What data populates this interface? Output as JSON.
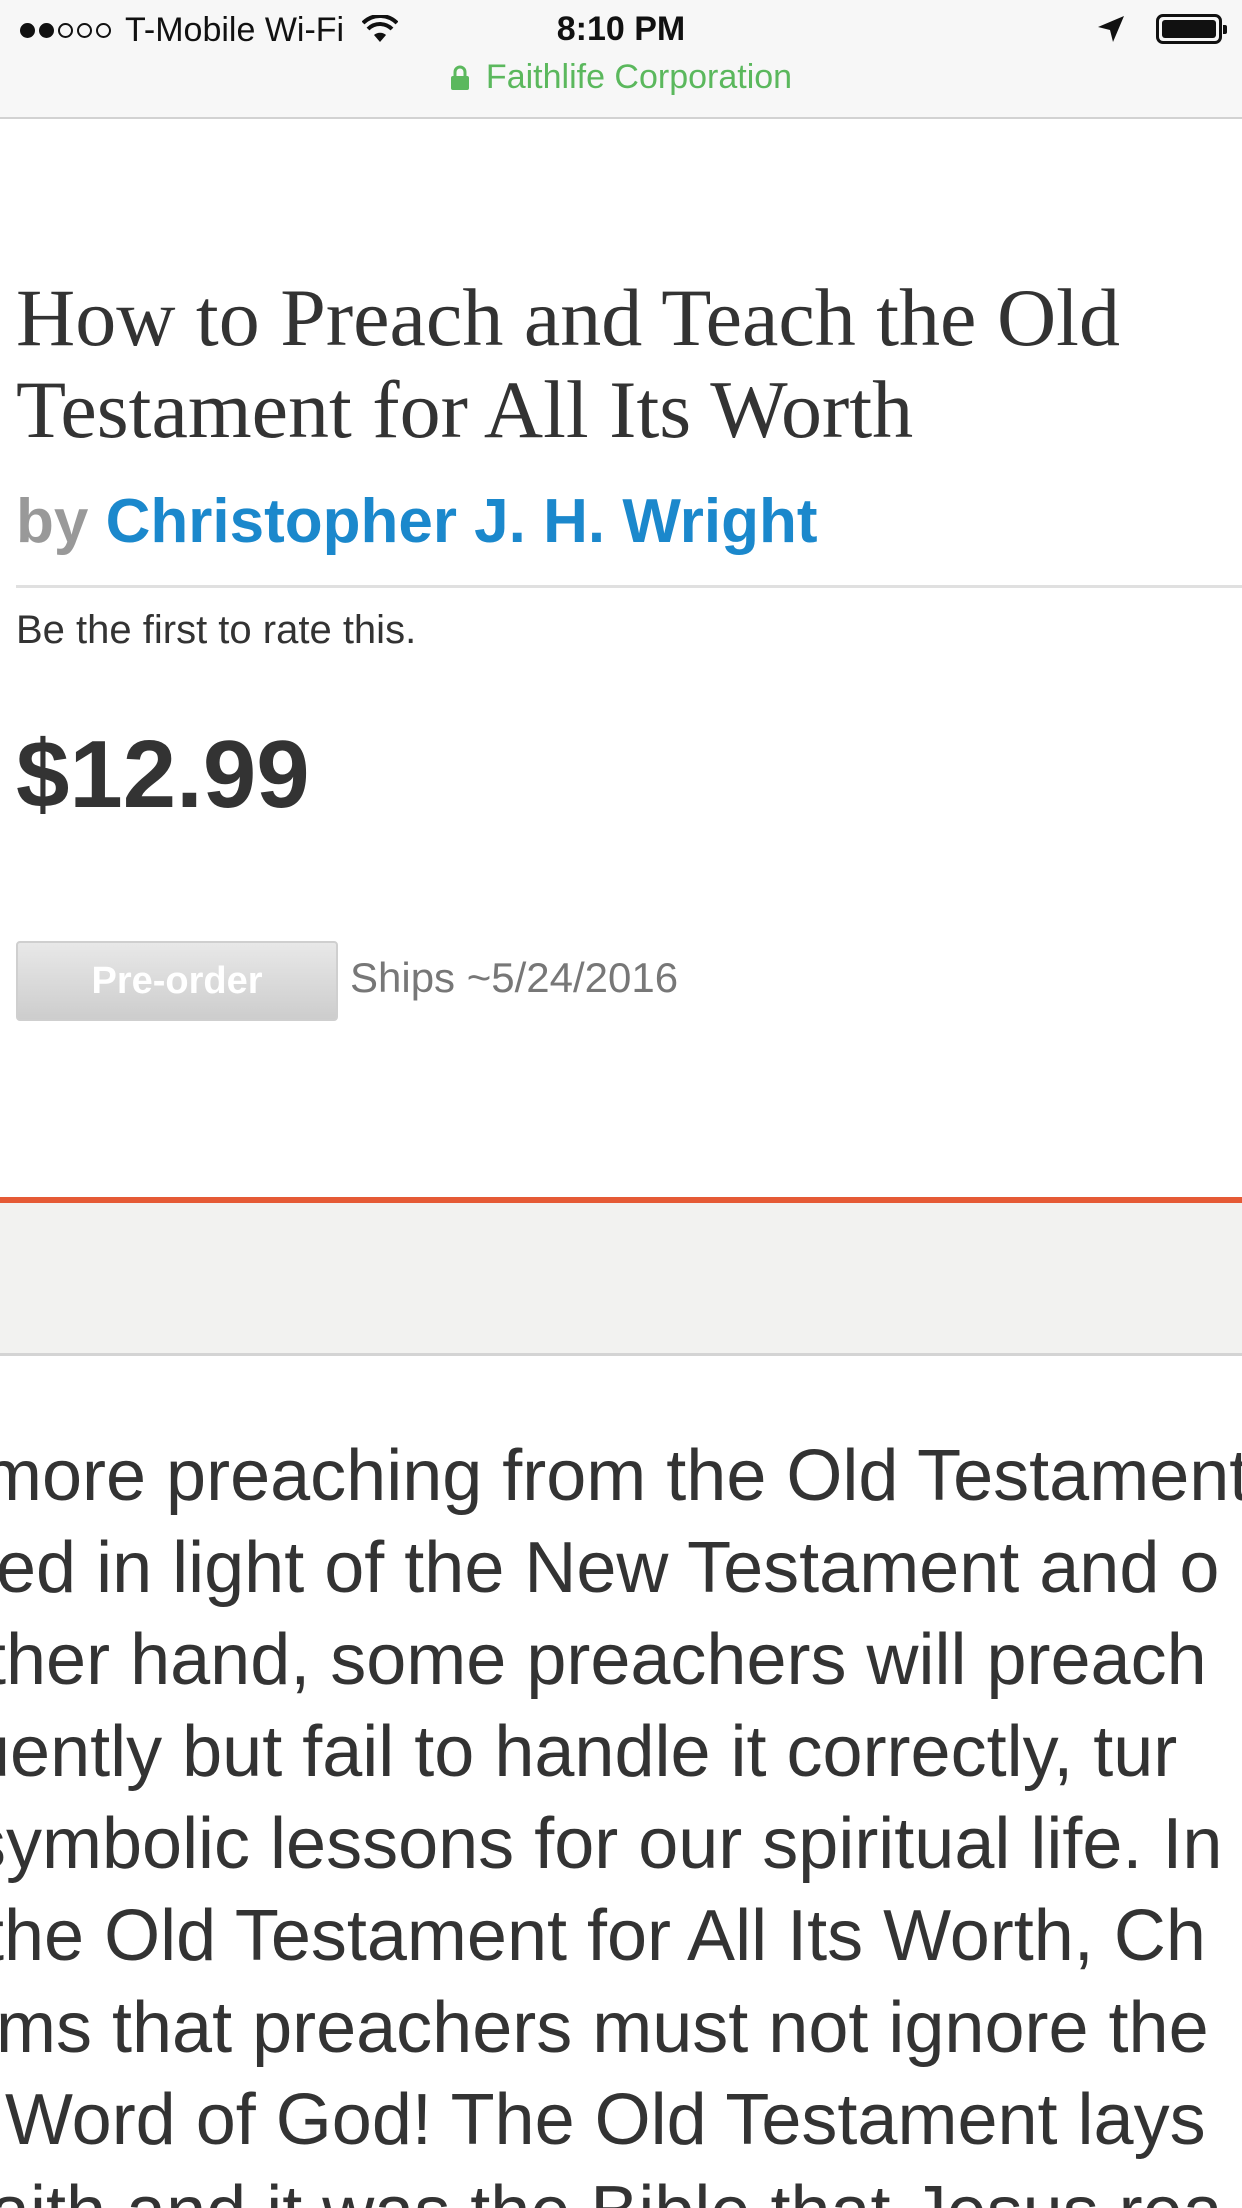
{
  "status_bar": {
    "carrier": "T-Mobile Wi-Fi",
    "signal_filled": 2,
    "signal_total": 5,
    "time": "8:10 PM",
    "battery_level": 1.0
  },
  "url_bar": {
    "site": "Faithlife Corporation"
  },
  "product": {
    "title": "How to Preach and Teach the Old Testament for All Its Worth",
    "by_label": "by",
    "author": "Christopher J. H. Wright",
    "rating_prompt": "Be the first to rate this.",
    "price": "$12.99",
    "preorder_label": "Pre-order",
    "ships_text": "Ships ~5/24/2016"
  },
  "description": {
    "lines": [
      "more preaching from the Old Testament",
      "ed in light of the New Testament and o",
      "ther hand, some preachers will preach",
      "uently but fail to handle it correctly, tur",
      "symbolic lessons for our spiritual life. In",
      "the Old Testament for All Its Worth, Ch",
      "ms that preachers must not ignore the",
      "Word of God! The Old Testament lays",
      "aith and it was the Bible that Jesus rea"
    ]
  },
  "colors": {
    "author_link": "#1b88cc",
    "secure_green": "#5bb85d",
    "accent_rule": "#e55a35",
    "text": "#333333"
  }
}
